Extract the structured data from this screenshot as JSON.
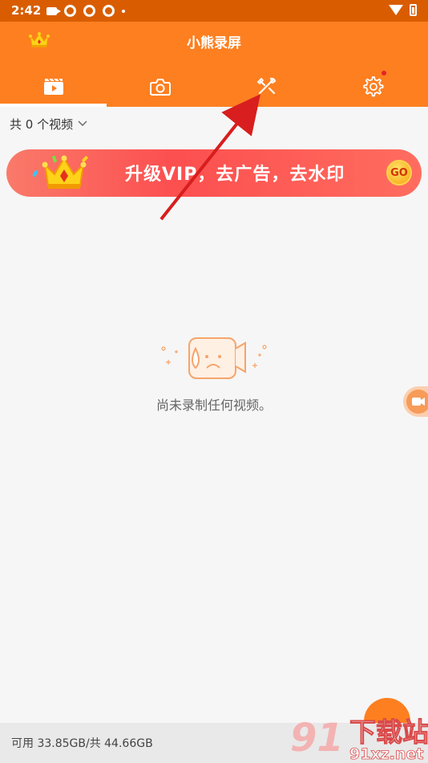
{
  "status_bar": {
    "time": "2:42",
    "icons": [
      "video-camera-icon",
      "sync-icon",
      "sync-icon",
      "sync-icon",
      "dot-icon",
      "wifi-icon",
      "battery-icon"
    ]
  },
  "app_bar": {
    "title": "小熊录屏",
    "vip_icon": "crown-icon",
    "tabs": [
      {
        "id": "videos",
        "icon": "video-list-icon",
        "active": true
      },
      {
        "id": "screenshots",
        "icon": "camera-icon",
        "active": false
      },
      {
        "id": "tools",
        "icon": "tools-icon",
        "active": false
      },
      {
        "id": "settings",
        "icon": "gear-icon",
        "active": false,
        "badge": true
      }
    ]
  },
  "filter": {
    "label": "共 0 个视频"
  },
  "banner": {
    "text": "升级VIP，去广告，去水印",
    "go_label": "GO"
  },
  "empty_state": {
    "message": "尚未录制任何视频。"
  },
  "storage": {
    "text": "可用 33.85GB/共 44.66GB"
  },
  "watermark": {
    "text": "下载站",
    "domain": "91xz.net"
  },
  "colors": {
    "primary": "#fd7f20",
    "status_bar": "#d95d00",
    "banner": "#fc4f4f",
    "annotation_arrow": "#d81e1e"
  }
}
